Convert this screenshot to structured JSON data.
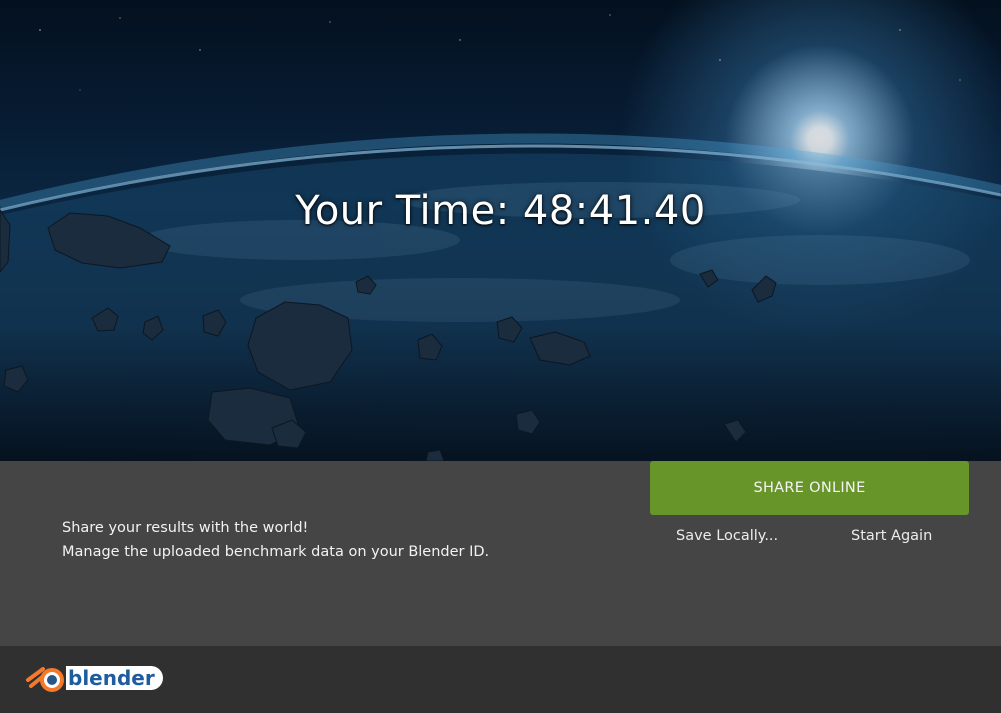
{
  "result": {
    "time_label": "Your Time: 48:41.40"
  },
  "share_panel": {
    "message_line1": "Share your results with the world!",
    "message_line2": "Manage the uploaded benchmark data on your Blender ID.",
    "share_button_label": "SHARE ONLINE",
    "save_locally_label": "Save Locally...",
    "start_again_label": "Start Again",
    "share_button_color": "#67952a"
  },
  "footer": {
    "logo_text": "blender"
  }
}
